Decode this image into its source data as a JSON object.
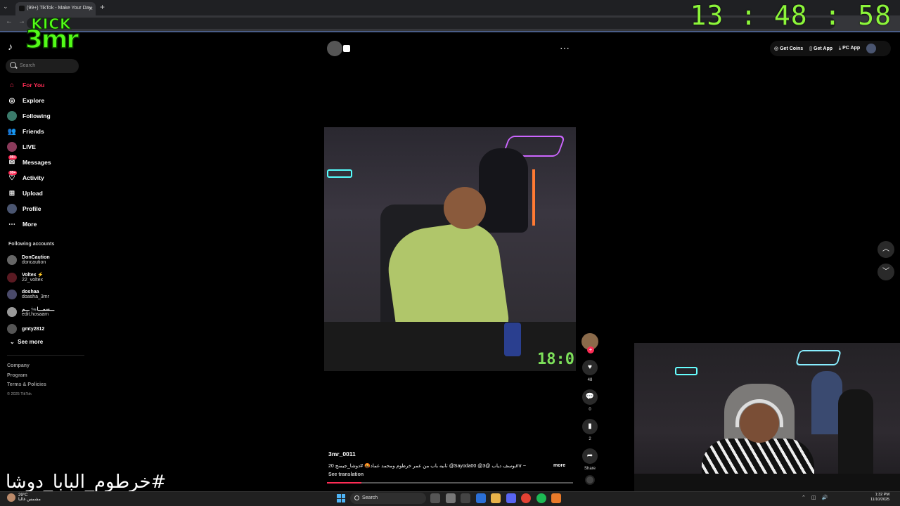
{
  "browser": {
    "tab_title": "(99+) TikTok - Make Your Day",
    "new_tab": "+",
    "tab_close": "×"
  },
  "overlay": {
    "logo_top": "KICK",
    "logo_name": "3mr",
    "clock": "13 : 48 : 58",
    "hashtag": "#خرطوم_البابا_دوشا"
  },
  "sidebar": {
    "search_placeholder": "Search",
    "items": [
      {
        "label": "For You",
        "icon": "home-icon"
      },
      {
        "label": "Explore",
        "icon": "compass-icon"
      },
      {
        "label": "Following",
        "icon": "following-avatar-icon"
      },
      {
        "label": "Friends",
        "icon": "friends-icon"
      },
      {
        "label": "LIVE",
        "icon": "live-icon"
      },
      {
        "label": "Messages",
        "icon": "messages-icon",
        "badge": "99+"
      },
      {
        "label": "Activity",
        "icon": "activity-icon",
        "badge": "99+"
      },
      {
        "label": "Upload",
        "icon": "upload-icon"
      },
      {
        "label": "Profile",
        "icon": "profile-avatar-icon"
      },
      {
        "label": "More",
        "icon": "more-icon"
      }
    ],
    "following_title": "Following accounts",
    "accounts": [
      {
        "display": "DonCaution",
        "user": "doncaution"
      },
      {
        "display": "Voltex ⚡",
        "user": "22_voltex"
      },
      {
        "display": "doshaa",
        "user": "doasha_3mr"
      },
      {
        "display": "ـــسمـــا🐜 ـــم",
        "user": "edit.hosaam"
      },
      {
        "display": "gmty2812",
        "user": ""
      }
    ],
    "see_more": "See more",
    "footer": [
      "Company",
      "Program",
      "Terms & Policies"
    ],
    "copyright": "© 2025 TikTok"
  },
  "video": {
    "timer": "18:0",
    "creator": "3mr_0011",
    "caption": "20 تانيه باب من عمر خرطوم ومحمد عماد🤬 #دوشا_جيمنج @Sayoda00 @يوسف دياب @3mr ~",
    "more": "more",
    "see_translation": "See translation",
    "progress": 0.14
  },
  "actions": {
    "plus": "+",
    "likes": "48",
    "comments": "0",
    "saves": "2",
    "share": "Share"
  },
  "top_right": {
    "coins": "Get Coins",
    "app": "Get App",
    "pc_app": "PC App"
  },
  "taskbar": {
    "weather_temp": "29°C",
    "weather_desc": "مشمس غالبا",
    "search": "Search",
    "time": "1:32 PM",
    "date": "11/10/2025"
  },
  "colors": {
    "accent": "#fe2c55",
    "kick_green": "#53fc18",
    "clock_green": "#8cf53a"
  }
}
